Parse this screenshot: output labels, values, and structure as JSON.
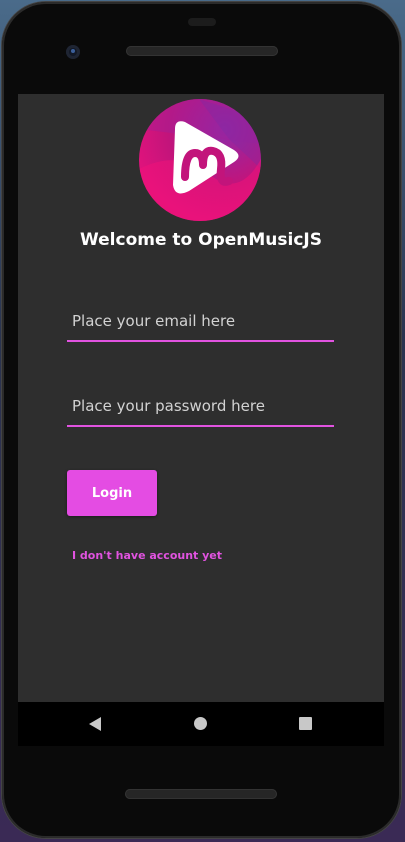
{
  "app": {
    "title": "Welcome to OpenMusicJS",
    "brand_color": "#e153e0",
    "logo_icon": "play-music-logo"
  },
  "form": {
    "email": {
      "placeholder": "Place your email here",
      "value": ""
    },
    "password": {
      "placeholder": "Place your password here",
      "value": ""
    },
    "login_label": "Login",
    "no_account_link": "I don't have account yet"
  },
  "navigation": {
    "icons": [
      "back-icon",
      "home-icon",
      "recents-icon"
    ]
  }
}
